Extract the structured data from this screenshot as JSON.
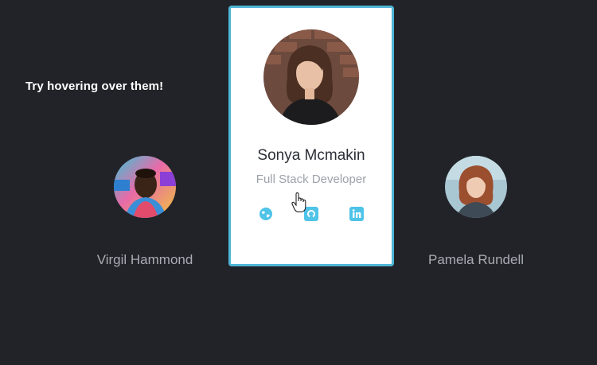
{
  "hint": "Try hovering over them!",
  "profiles": {
    "left": {
      "name": "Virgil Hammond"
    },
    "center": {
      "name": "Sonya Mcmakin",
      "role": "Full Stack Developer"
    },
    "right": {
      "name": "Pamela Rundell"
    }
  },
  "social_icons": [
    "globe-icon",
    "github-icon",
    "linkedin-icon"
  ],
  "colors": {
    "background": "#212328",
    "card_border": "#4fb6d6",
    "icon_accent": "#4fc3e8",
    "muted_text": "#a8acb3"
  }
}
